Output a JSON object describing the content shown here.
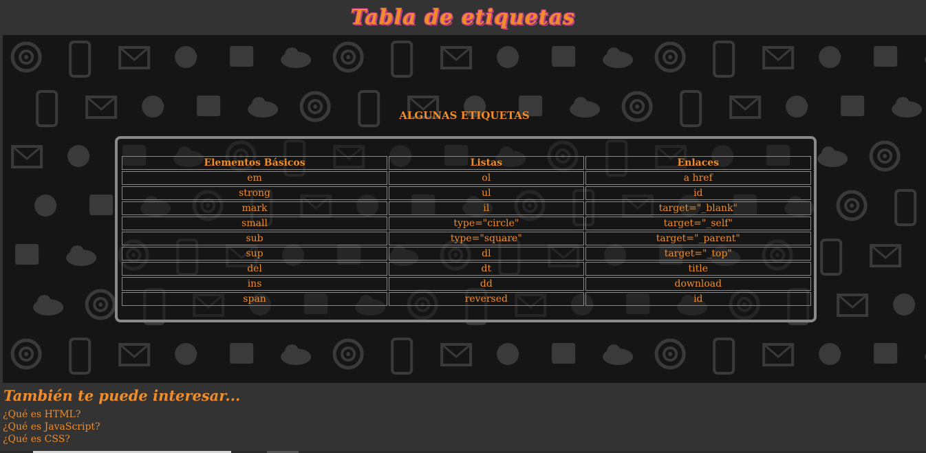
{
  "header": {
    "title": "Tabla de etiquetas"
  },
  "main": {
    "section_title": "ALGUNAS ETIQUETAS",
    "table": {
      "headers": [
        "Elementos Básicos",
        "Listas",
        "Enlaces"
      ],
      "rows": [
        [
          "em",
          "ol",
          "a href"
        ],
        [
          "strong",
          "ul",
          "id"
        ],
        [
          "mark",
          "il",
          "target=\"_blank\""
        ],
        [
          "small",
          "type=\"circle\"",
          "target=\"_self\""
        ],
        [
          "sub",
          "type=\"square\"",
          "target=\"_parent\""
        ],
        [
          "sup",
          "dl",
          "target=\"_top\""
        ],
        [
          "del",
          "dt",
          "title"
        ],
        [
          "ins",
          "dd",
          "download"
        ],
        [
          "span",
          "reversed",
          "id"
        ]
      ]
    }
  },
  "footer": {
    "title": "También te puede interesar...",
    "links": [
      "¿Qué es HTML?",
      "¿Qué es JavaScript?",
      "¿Qué es CSS?"
    ]
  },
  "colors": {
    "accent": "#f08c2c",
    "title_outline": "#c23d8a",
    "background": "#333333",
    "panel": "#151515",
    "border": "#8a8a8a"
  }
}
